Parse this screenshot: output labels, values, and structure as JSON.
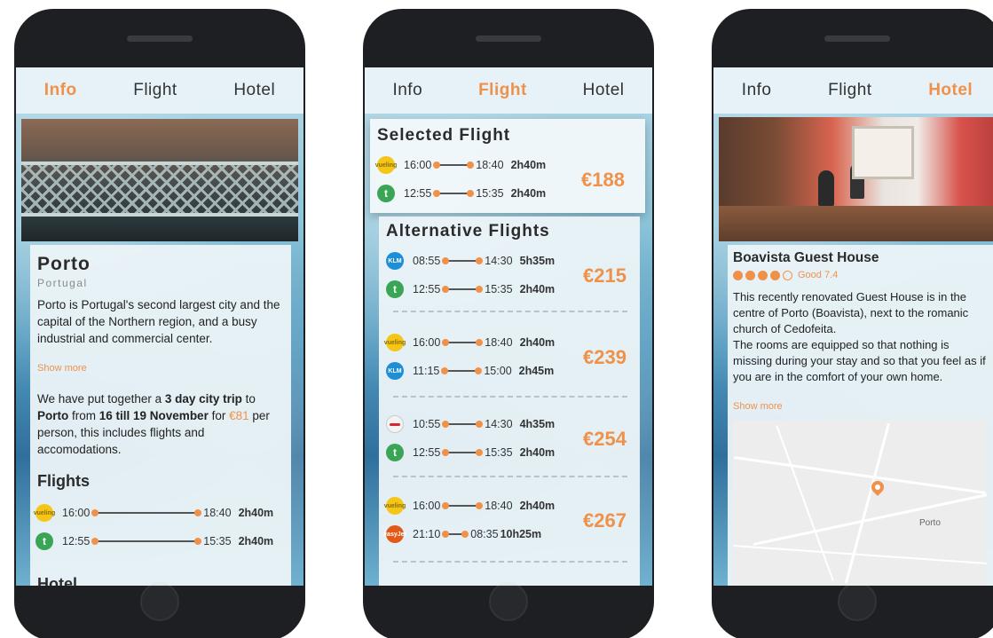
{
  "tabs": {
    "info": "Info",
    "flight": "Flight",
    "hotel": "Hotel"
  },
  "info": {
    "city": "Porto",
    "country": "Portugal",
    "description": "Porto is Portugal's second largest city and the capital of the Northern region, and a busy industrial and commercial center.",
    "show_more": "Show more",
    "trip_prefix": "We have put together a ",
    "trip_duration": "3 day city trip",
    "trip_to": " to ",
    "trip_city": "Porto",
    "trip_from": " from ",
    "trip_dates": "16 till 19 November",
    "trip_for": " for ",
    "trip_price": "€81",
    "trip_suffix": " per person, this includes flights and accomodations.",
    "flights_heading": "Flights",
    "flights": [
      {
        "airline_icon": "vueling-logo",
        "dep": "16:00",
        "arr": "18:40",
        "dur": "2h40m"
      },
      {
        "airline_icon": "transavia-logo",
        "dep": "12:55",
        "arr": "15:35",
        "dur": "2h40m"
      }
    ],
    "hotel_heading": "Hotel"
  },
  "flight": {
    "selected_heading": "Selected Flight",
    "selected": {
      "price": "€188",
      "legs": [
        {
          "airline_icon": "vueling-logo",
          "dep": "16:00",
          "arr": "18:40",
          "dur": "2h40m"
        },
        {
          "airline_icon": "transavia-logo",
          "dep": "12:55",
          "arr": "15:35",
          "dur": "2h40m"
        }
      ]
    },
    "alt_heading": "Alternative Flights",
    "alternatives": [
      {
        "price": "€215",
        "legs": [
          {
            "airline_icon": "klm-logo",
            "dep": "08:55",
            "arr": "14:30",
            "dur": "5h35m"
          },
          {
            "airline_icon": "transavia-logo",
            "dep": "12:55",
            "arr": "15:35",
            "dur": "2h40m"
          }
        ]
      },
      {
        "price": "€239",
        "legs": [
          {
            "airline_icon": "vueling-logo",
            "dep": "16:00",
            "arr": "18:40",
            "dur": "2h40m"
          },
          {
            "airline_icon": "klm-logo",
            "dep": "11:15",
            "arr": "15:00",
            "dur": "2h45m"
          }
        ]
      },
      {
        "price": "€254",
        "legs": [
          {
            "airline_icon": "british-airways-logo",
            "dep": "10:55",
            "arr": "14:30",
            "dur": "4h35m"
          },
          {
            "airline_icon": "transavia-logo",
            "dep": "12:55",
            "arr": "15:35",
            "dur": "2h40m"
          }
        ]
      },
      {
        "price": "€267",
        "legs": [
          {
            "airline_icon": "vueling-logo",
            "dep": "16:00",
            "arr": "18:40",
            "dur": "2h40m"
          },
          {
            "airline_icon": "easyjet-logo",
            "dep": "21:10",
            "arr": "08:35",
            "dur": "10h25m"
          }
        ]
      }
    ]
  },
  "hotel": {
    "name": "Boavista Guest House",
    "rating_filled": 4,
    "rating_total": 5,
    "rating_text": "Good 7.4",
    "description_1": "This recently renovated Guest House is in the centre of Porto (Boavista), next to the romanic church of Cedofeita.",
    "description_2": "The rooms are equipped so that nothing is missing during your stay and so that you feel as if you are in the comfort of your own home.",
    "show_more": "Show more",
    "map_label": "Porto"
  },
  "colors": {
    "accent": "#f0914a",
    "phone": "#1e1f22",
    "tabbar": "#e7f3f8"
  }
}
